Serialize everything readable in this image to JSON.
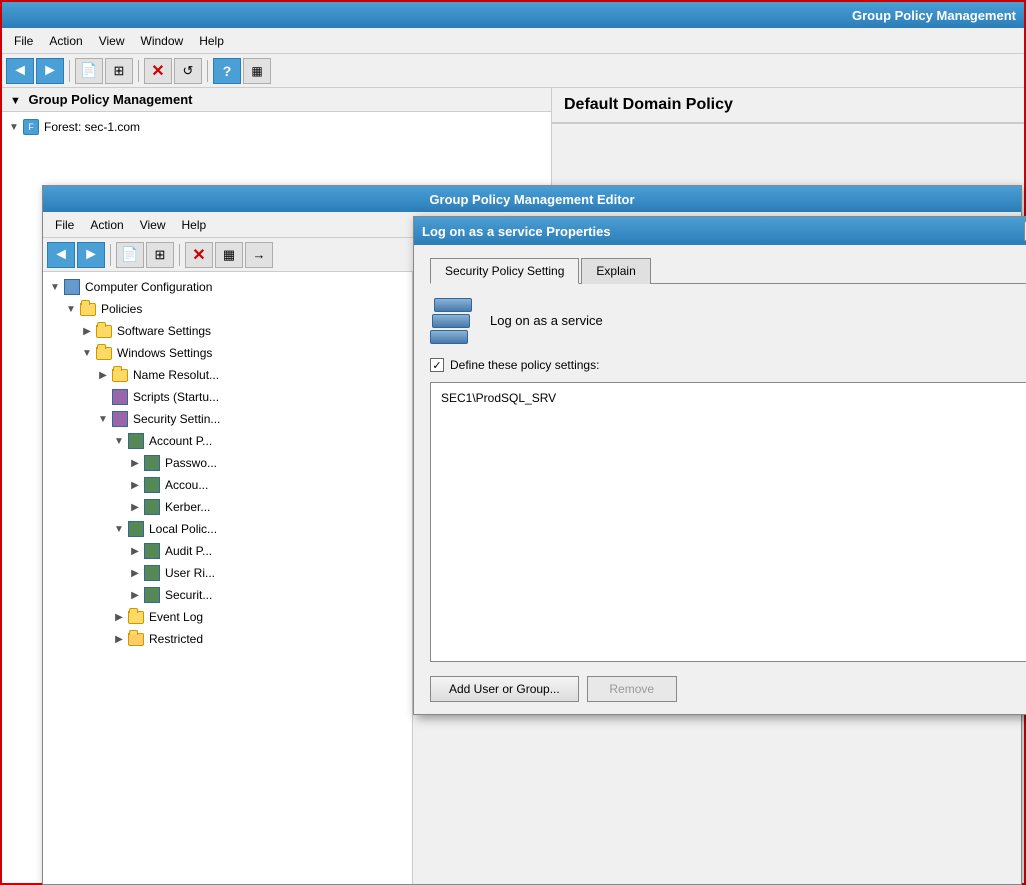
{
  "outer_window": {
    "title": "Group Policy Management",
    "menu": [
      "File",
      "Action",
      "View",
      "Window",
      "Help"
    ]
  },
  "outer_left": {
    "panel_title": "Group Policy Management",
    "tree_root": "Forest: sec-1.com"
  },
  "outer_right": {
    "title": "Default Domain Policy"
  },
  "inner_window": {
    "title": "Group Policy Management Editor",
    "menu": [
      "File",
      "Action",
      "View",
      "Help"
    ],
    "tree": [
      {
        "label": "Computer Configuration",
        "level": 0,
        "expanded": true,
        "type": "computer"
      },
      {
        "label": "Policies",
        "level": 1,
        "expanded": true,
        "type": "folder"
      },
      {
        "label": "Software Settings",
        "level": 2,
        "expanded": false,
        "type": "folder"
      },
      {
        "label": "Windows Settings",
        "level": 2,
        "expanded": true,
        "type": "folder"
      },
      {
        "label": "Name Resolution",
        "level": 3,
        "expanded": false,
        "type": "folder"
      },
      {
        "label": "Scripts (Startup)",
        "level": 3,
        "expanded": false,
        "type": "policy"
      },
      {
        "label": "Security Settings",
        "level": 3,
        "expanded": true,
        "type": "folder"
      },
      {
        "label": "Account Policies",
        "level": 4,
        "expanded": true,
        "type": "policy"
      },
      {
        "label": "Password",
        "level": 5,
        "expanded": false,
        "type": "policy"
      },
      {
        "label": "Account",
        "level": 5,
        "expanded": false,
        "type": "policy"
      },
      {
        "label": "Kerberos",
        "level": 5,
        "expanded": false,
        "type": "policy"
      },
      {
        "label": "Local Policies",
        "level": 4,
        "expanded": true,
        "type": "policy"
      },
      {
        "label": "Audit P...",
        "level": 5,
        "expanded": false,
        "type": "policy"
      },
      {
        "label": "User Ri...",
        "level": 5,
        "expanded": false,
        "type": "policy"
      },
      {
        "label": "Security...",
        "level": 5,
        "expanded": false,
        "type": "policy"
      },
      {
        "label": "Event Log",
        "level": 4,
        "expanded": false,
        "type": "folder"
      },
      {
        "label": "Restricted",
        "level": 4,
        "expanded": false,
        "type": "folder"
      }
    ]
  },
  "dialog": {
    "title": "Log on as a service Properties",
    "help_label": "?",
    "tabs": [
      {
        "label": "Security Policy Setting",
        "active": true
      },
      {
        "label": "Explain",
        "active": false
      }
    ],
    "policy_icon_alt": "server-stack",
    "policy_name": "Log on as a service",
    "define_checkbox_label": "Define these policy settings:",
    "define_checked": true,
    "members": [
      "SEC1\\ProdSQL_SRV"
    ],
    "buttons": {
      "add": "Add User or Group...",
      "remove": "Remove"
    }
  },
  "toolbar": {
    "back": "◄",
    "forward": "►",
    "up": "↑",
    "show_hide": "⊞",
    "delete": "✕",
    "properties": "≡",
    "export": "→",
    "help": "?",
    "refresh": "↺",
    "new": "📄"
  }
}
